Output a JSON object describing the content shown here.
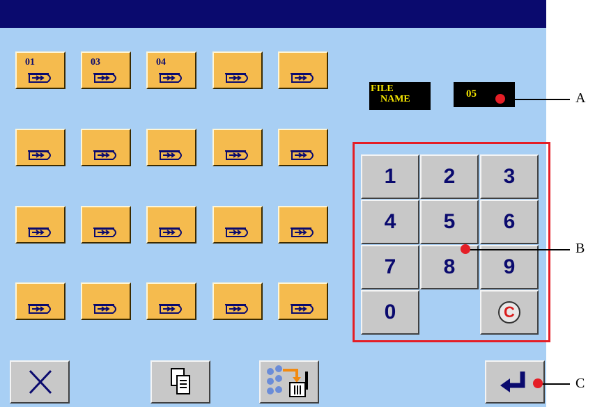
{
  "file_tiles": [
    {
      "number": "01"
    },
    {
      "number": "03"
    },
    {
      "number": "04"
    },
    {
      "number": ""
    },
    {
      "number": ""
    },
    {
      "number": ""
    },
    {
      "number": ""
    },
    {
      "number": ""
    },
    {
      "number": ""
    },
    {
      "number": ""
    },
    {
      "number": ""
    },
    {
      "number": ""
    },
    {
      "number": ""
    },
    {
      "number": ""
    },
    {
      "number": ""
    },
    {
      "number": ""
    },
    {
      "number": ""
    },
    {
      "number": ""
    },
    {
      "number": ""
    },
    {
      "number": ""
    }
  ],
  "file_name": {
    "label_line1": "FILE",
    "label_line2": "NAME",
    "value": "05"
  },
  "keypad": {
    "keys": [
      "1",
      "2",
      "3",
      "4",
      "5",
      "6",
      "7",
      "8",
      "9",
      "0"
    ],
    "clear_label": "C"
  },
  "bottom_buttons": {
    "cancel_icon": "close-icon",
    "copy_icon": "copy-icon",
    "delete_icon": "delete-file-icon",
    "enter_icon": "enter-icon"
  },
  "callouts": [
    "A",
    "B",
    "C"
  ],
  "colors": {
    "background": "#a8cff4",
    "title_bar": "#0a0a6e",
    "tile": "#f5bb4e",
    "key": "#c8c8c8",
    "highlight": "#e41e26",
    "label_text": "#f5e600"
  }
}
